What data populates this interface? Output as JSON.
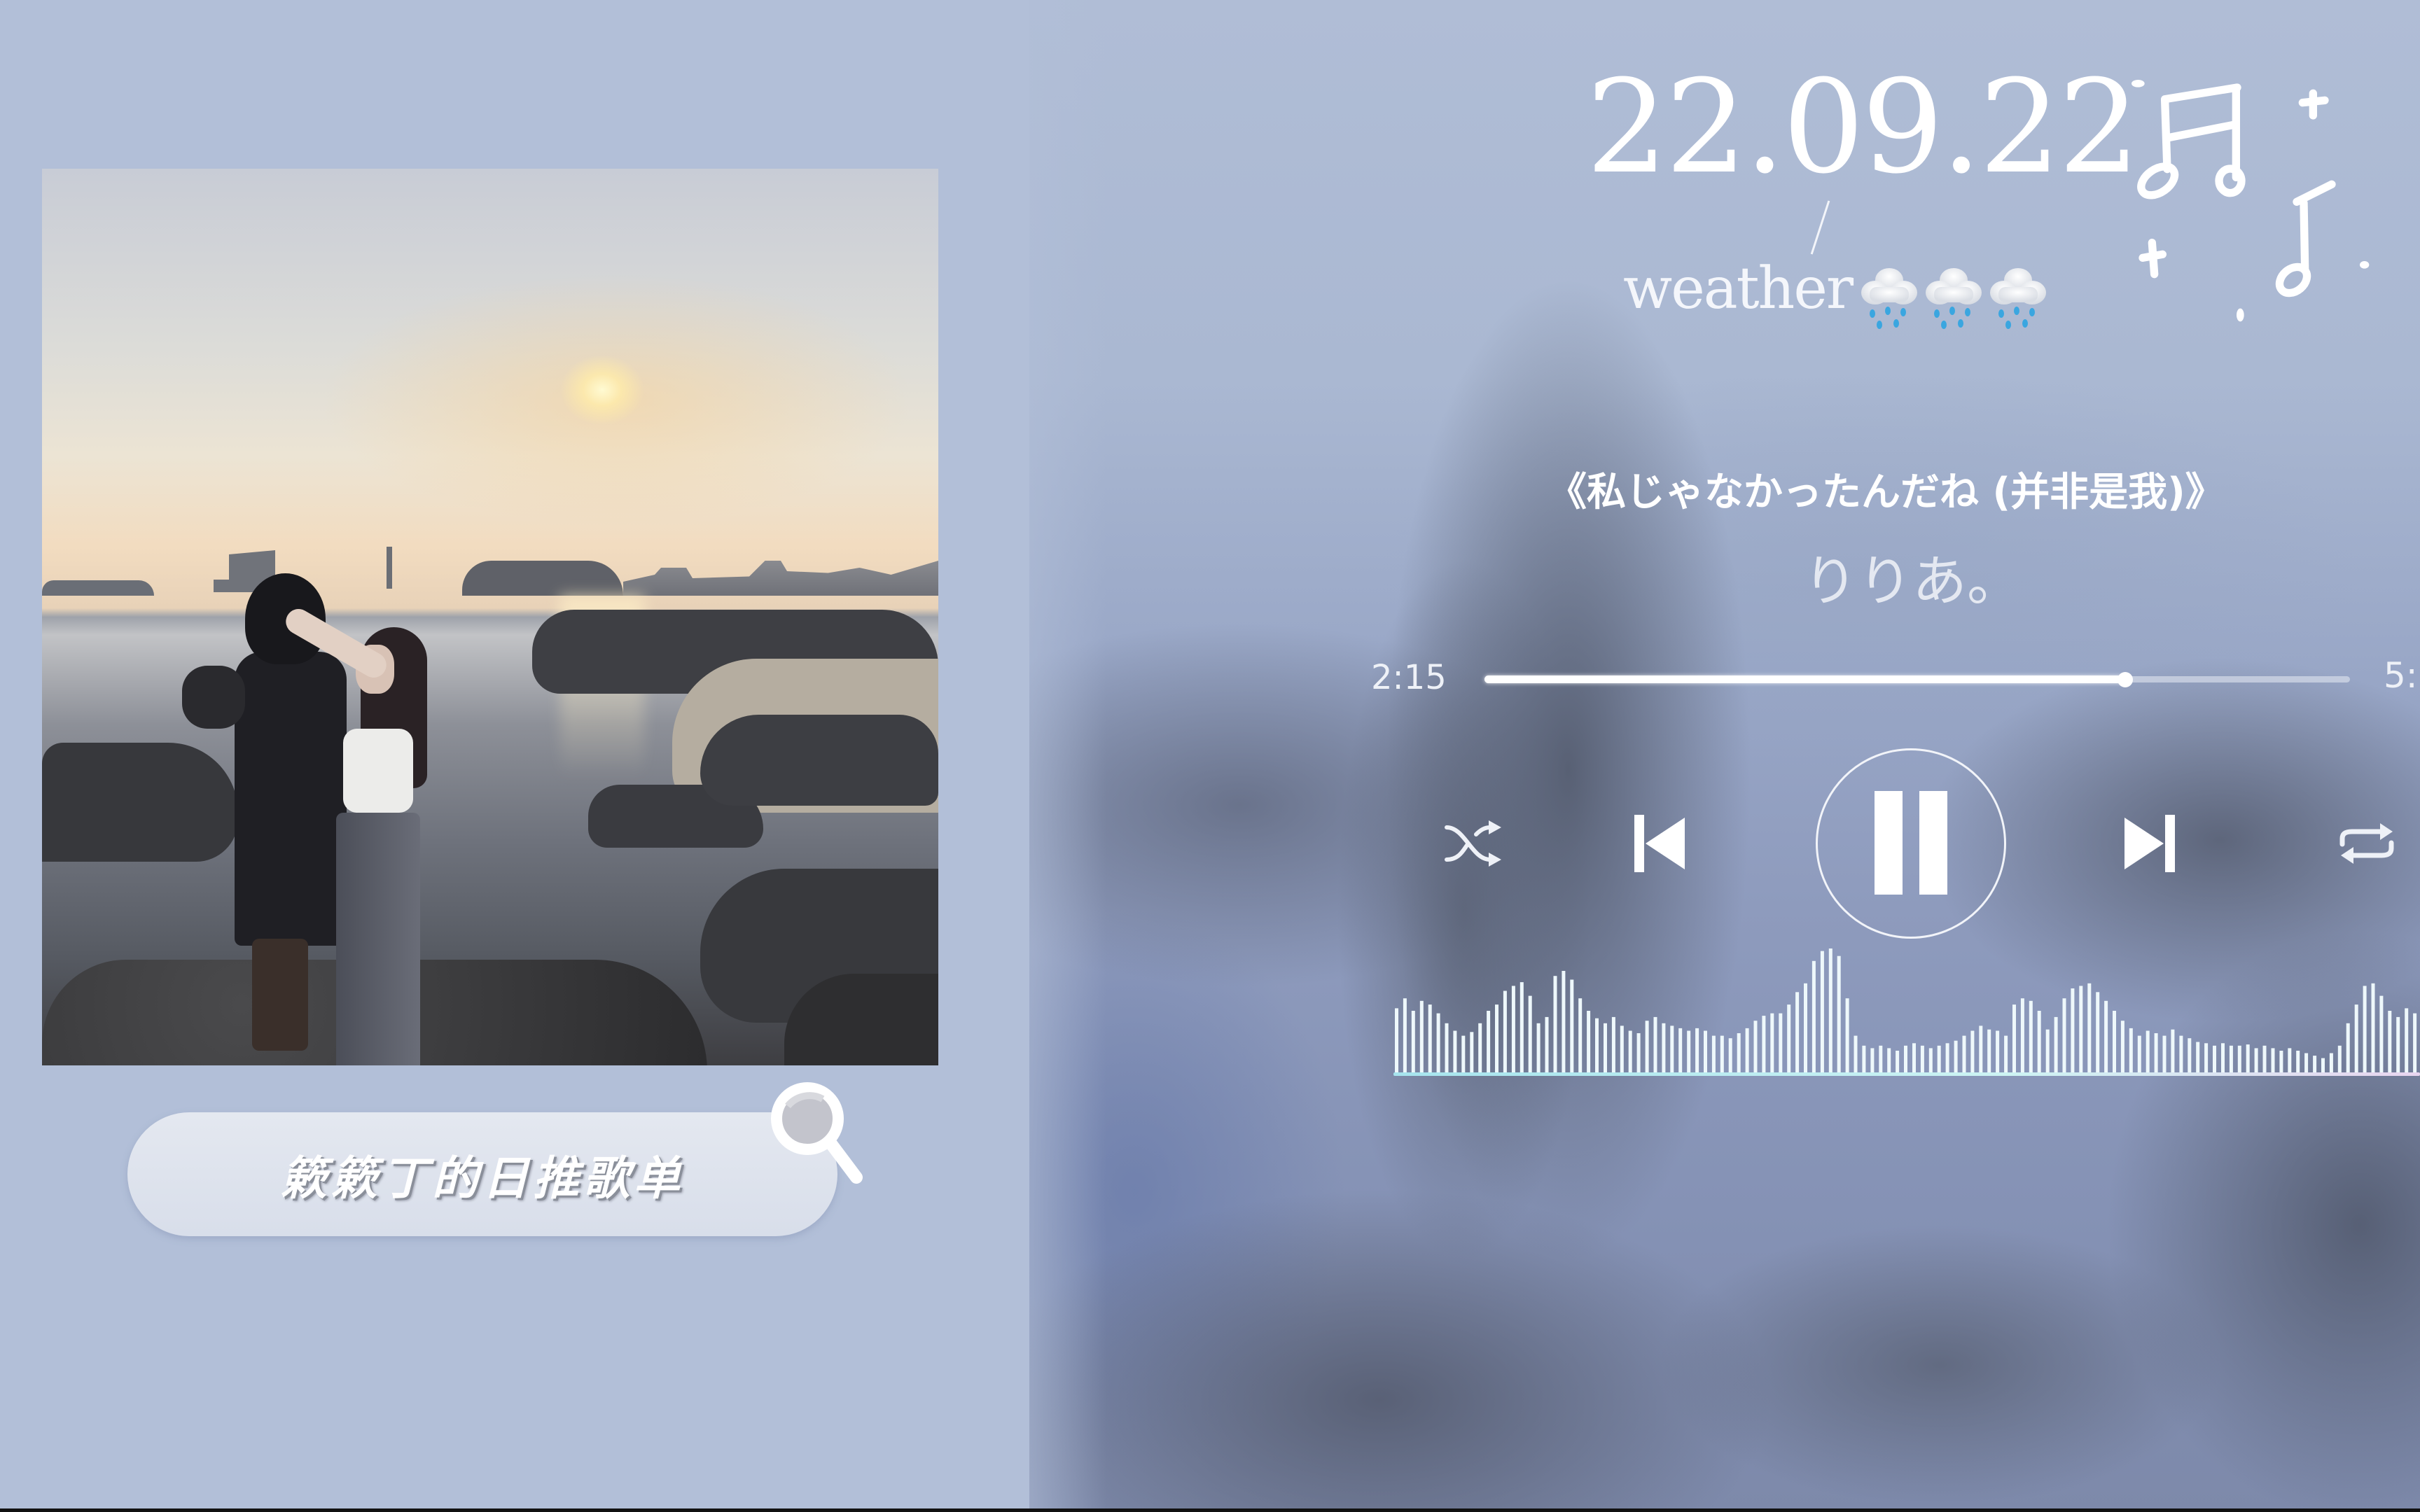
{
  "playlist": {
    "label": "簌簌丁的日推歌单",
    "search_icon": "magnifier-icon"
  },
  "header": {
    "date": "22.09.22",
    "separator": "/",
    "weather_label": "weather",
    "weather_icons": [
      "cloud-rain-icon",
      "cloud-rain-icon",
      "cloud-rain-icon"
    ],
    "decoration": "music-notes-doodle"
  },
  "player": {
    "song_title": "《私じゃなかったんだね (并非是我)》",
    "artist": "りりあ。",
    "time_current": "2:15",
    "time_total": "5:",
    "progress_fraction": 0.74,
    "state": "playing",
    "controls": {
      "shuffle": "shuffle-icon",
      "previous": "skip-previous-icon",
      "pause": "pause-icon",
      "next": "skip-next-icon",
      "repeat": "repeat-icon"
    },
    "waveform_levels": [
      0.52,
      0.6,
      0.5,
      0.58,
      0.55,
      0.48,
      0.4,
      0.34,
      0.3,
      0.33,
      0.4,
      0.5,
      0.55,
      0.66,
      0.7,
      0.73,
      0.62,
      0.4,
      0.45,
      0.78,
      0.82,
      0.75,
      0.6,
      0.5,
      0.44,
      0.4,
      0.45,
      0.38,
      0.34,
      0.32,
      0.42,
      0.45,
      0.4,
      0.38,
      0.36,
      0.34,
      0.36,
      0.34,
      0.3,
      0.3,
      0.28,
      0.32,
      0.36,
      0.42,
      0.46,
      0.48,
      0.48,
      0.55,
      0.65,
      0.72,
      0.9,
      0.98,
      1.0,
      0.94,
      0.6,
      0.3,
      0.22,
      0.2,
      0.22,
      0.2,
      0.18,
      0.22,
      0.24,
      0.22,
      0.2,
      0.22,
      0.24,
      0.26,
      0.3,
      0.34,
      0.38,
      0.35,
      0.34,
      0.3,
      0.55,
      0.6,
      0.58,
      0.5,
      0.35,
      0.45,
      0.6,
      0.68,
      0.7,
      0.72,
      0.65,
      0.58,
      0.5,
      0.42,
      0.36,
      0.3,
      0.34,
      0.32,
      0.3,
      0.35,
      0.3,
      0.28,
      0.25,
      0.24,
      0.22,
      0.24,
      0.22,
      0.22,
      0.23,
      0.2,
      0.22,
      0.2,
      0.18,
      0.2,
      0.18,
      0.16,
      0.14,
      0.12,
      0.16,
      0.22,
      0.4,
      0.55,
      0.7,
      0.72,
      0.62,
      0.5,
      0.45,
      0.52,
      0.48
    ]
  },
  "colors": {
    "background": "#b2bfd8",
    "text": "#ffffff",
    "waveform_bar": "#eef8fb",
    "waveform_baseline": "#a6e4ee"
  }
}
